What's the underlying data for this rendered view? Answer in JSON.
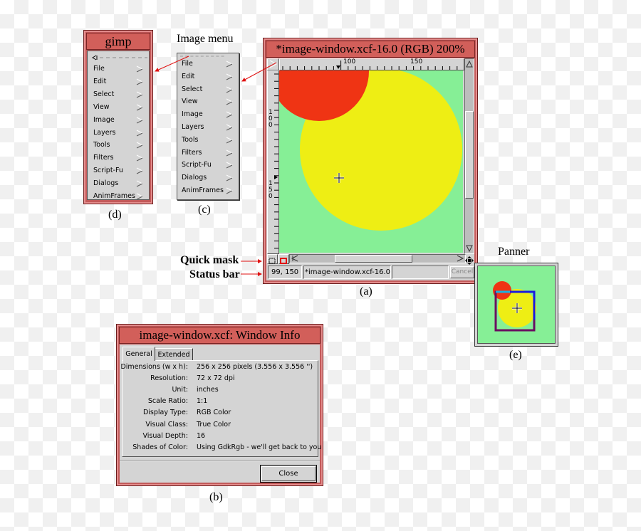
{
  "gimp_menu": {
    "title": "gimp",
    "caption": "(d)",
    "items": [
      {
        "label": "File"
      },
      {
        "label": "Edit"
      },
      {
        "label": "Select"
      },
      {
        "label": "View"
      },
      {
        "label": "Image"
      },
      {
        "label": "Layers"
      },
      {
        "label": "Tools"
      },
      {
        "label": "Filters"
      },
      {
        "label": "Script-Fu"
      },
      {
        "label": "Dialogs"
      },
      {
        "label": "AnimFrames"
      }
    ]
  },
  "image_menu": {
    "annotation": "Image menu",
    "caption": "(c)",
    "items": [
      {
        "label": "File"
      },
      {
        "label": "Edit"
      },
      {
        "label": "Select"
      },
      {
        "label": "View"
      },
      {
        "label": "Image"
      },
      {
        "label": "Layers"
      },
      {
        "label": "Tools"
      },
      {
        "label": "Filters"
      },
      {
        "label": "Script-Fu"
      },
      {
        "label": "Dialogs"
      },
      {
        "label": "AnimFrames"
      }
    ]
  },
  "image_window": {
    "title": "*image-window.xcf-16.0 (RGB) 200%",
    "caption": "(a)",
    "hruler_labels": [
      "100",
      "150"
    ],
    "vruler_labels": [
      "100",
      "150"
    ],
    "status": {
      "coords": "99, 150",
      "message": "*image-window.xcf-16.0",
      "progress": "",
      "cancel_label": "Cancel"
    },
    "annotations": {
      "quick_mask": "Quick mask",
      "status_bar": "Status bar"
    },
    "canvas_colors": {
      "background": "#86ef96",
      "large_circle": "#eeee14",
      "small_circle": "#ef3414"
    }
  },
  "panner": {
    "label": "Panner",
    "caption": "(e)",
    "colors": {
      "viewport": "#6a0f60",
      "viewport_highlight": "#1a1ae0"
    }
  },
  "window_info": {
    "title": "image-window.xcf: Window Info",
    "caption": "(b)",
    "tabs": [
      {
        "label": "General",
        "active": true
      },
      {
        "label": "Extended",
        "active": false
      }
    ],
    "rows": [
      {
        "key": "Dimensions (w x h):",
        "value": "256 x 256 pixels (3.556 x 3.556 '')"
      },
      {
        "key": "Resolution:",
        "value": "72 x 72 dpi"
      },
      {
        "key": "Unit:",
        "value": "inches"
      },
      {
        "key": "Scale Ratio:",
        "value": "1:1"
      },
      {
        "key": "Display Type:",
        "value": "RGB Color"
      },
      {
        "key": "Visual Class:",
        "value": "True Color"
      },
      {
        "key": "Visual Depth:",
        "value": "16"
      },
      {
        "key": "Shades of Color:",
        "value": "Using GdkRgb - we'll get back to you"
      }
    ],
    "close_label": "Close"
  },
  "accent_colors": {
    "title_bar": "#d25f5a",
    "frame": "#c25a5a",
    "arrow": "#e01010"
  }
}
